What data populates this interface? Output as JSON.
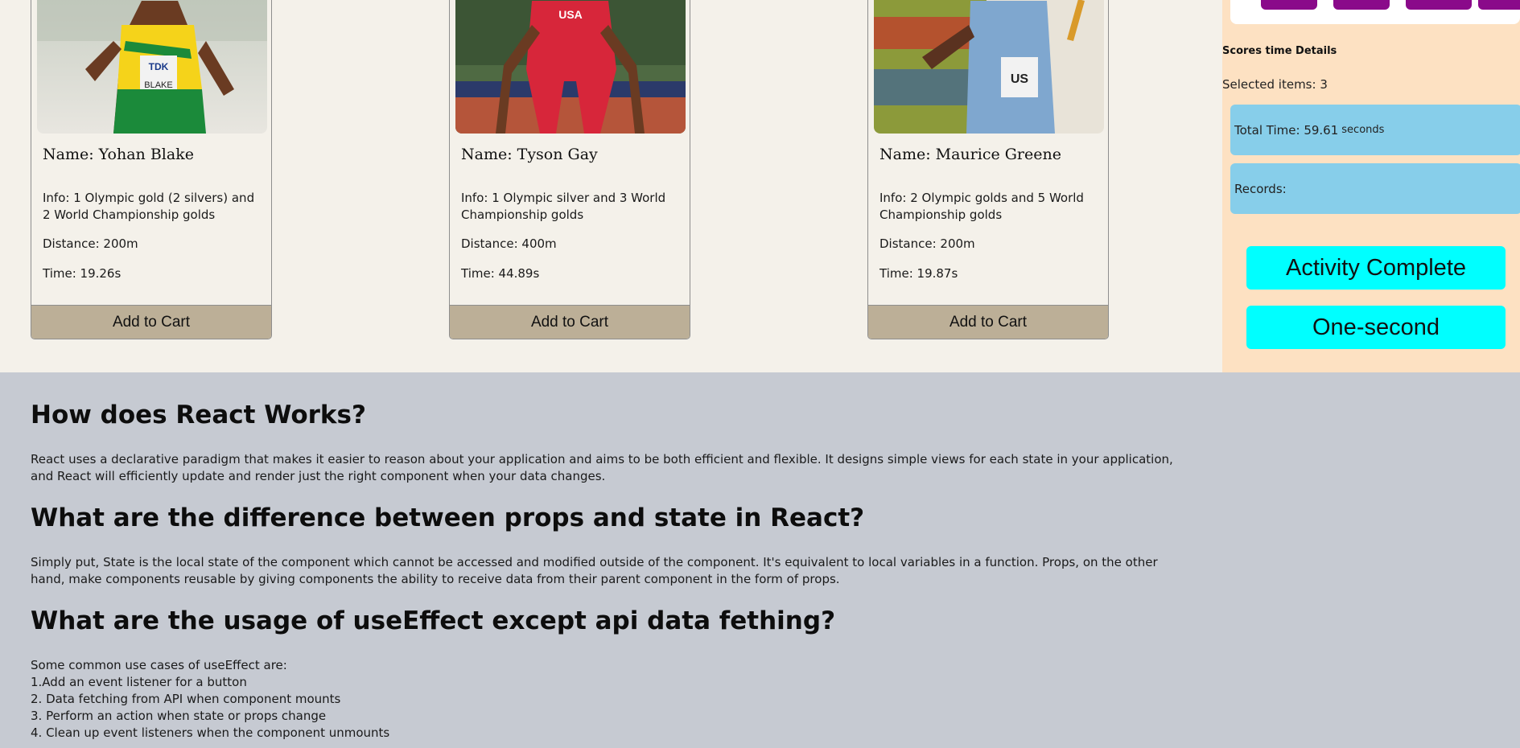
{
  "cards": [
    {
      "name": "Name: Yohan Blake",
      "info": "Info: 1 Olympic gold (2 silvers) and 2 World Championship golds",
      "distance": "Distance: 200m",
      "time": "Time: 19.26s",
      "cart_label": "Add to Cart"
    },
    {
      "name": "Name: Tyson Gay",
      "info": "Info: 1 Olympic silver and 3 World Championship golds",
      "distance": "Distance: 400m",
      "time": "Time: 44.89s",
      "cart_label": "Add to Cart"
    },
    {
      "name": "Name: Maurice Greene",
      "info": "Info: 2 Olympic golds and 5 World Championship golds",
      "distance": "Distance: 200m",
      "time": "Time: 19.87s",
      "cart_label": "Add to Cart"
    }
  ],
  "sidebar": {
    "heading": "Scores time Details",
    "selected": "Selected items: 3",
    "total_time_label": "Total Time: 59.61",
    "total_time_unit": "seconds",
    "records_label": "Records:",
    "activity_button": "Activity Complete",
    "one_second_button": "One-second"
  },
  "qa": [
    {
      "question": "How does React Works?",
      "answer": "React uses a declarative paradigm that makes it easier to reason about your application and aims to be both efficient and flexible. It designs simple views for each state in your application, and React will efficiently update and render just the right component when your data changes."
    },
    {
      "question": "What are the difference between props and state in React?",
      "answer": "Simply put, State is the local state of the component which cannot be accessed and modified outside of the component. It's equivalent to local variables in a function. Props, on the other hand, make components reusable by giving components the ability to receive data from their parent component in the form of props."
    },
    {
      "question": "What are the usage of useEffect except api data fething?",
      "answer_lines": [
        "Some common use cases of useEffect are:",
        "1.Add an event listener for a button",
        "2. Data fetching from API when component mounts",
        "3. Perform an action when state or props change",
        "4. Clean up event listeners when the component unmounts"
      ]
    }
  ],
  "colors": {
    "page_bg": "#c6cad2",
    "cards_bg": "#f4f1ea",
    "sidebar_bg": "#fde1c2",
    "cart_button": "#bcaf97",
    "info_box": "#87ceea",
    "action_button": "#00ffff",
    "pill_button": "#8a0a8a"
  }
}
